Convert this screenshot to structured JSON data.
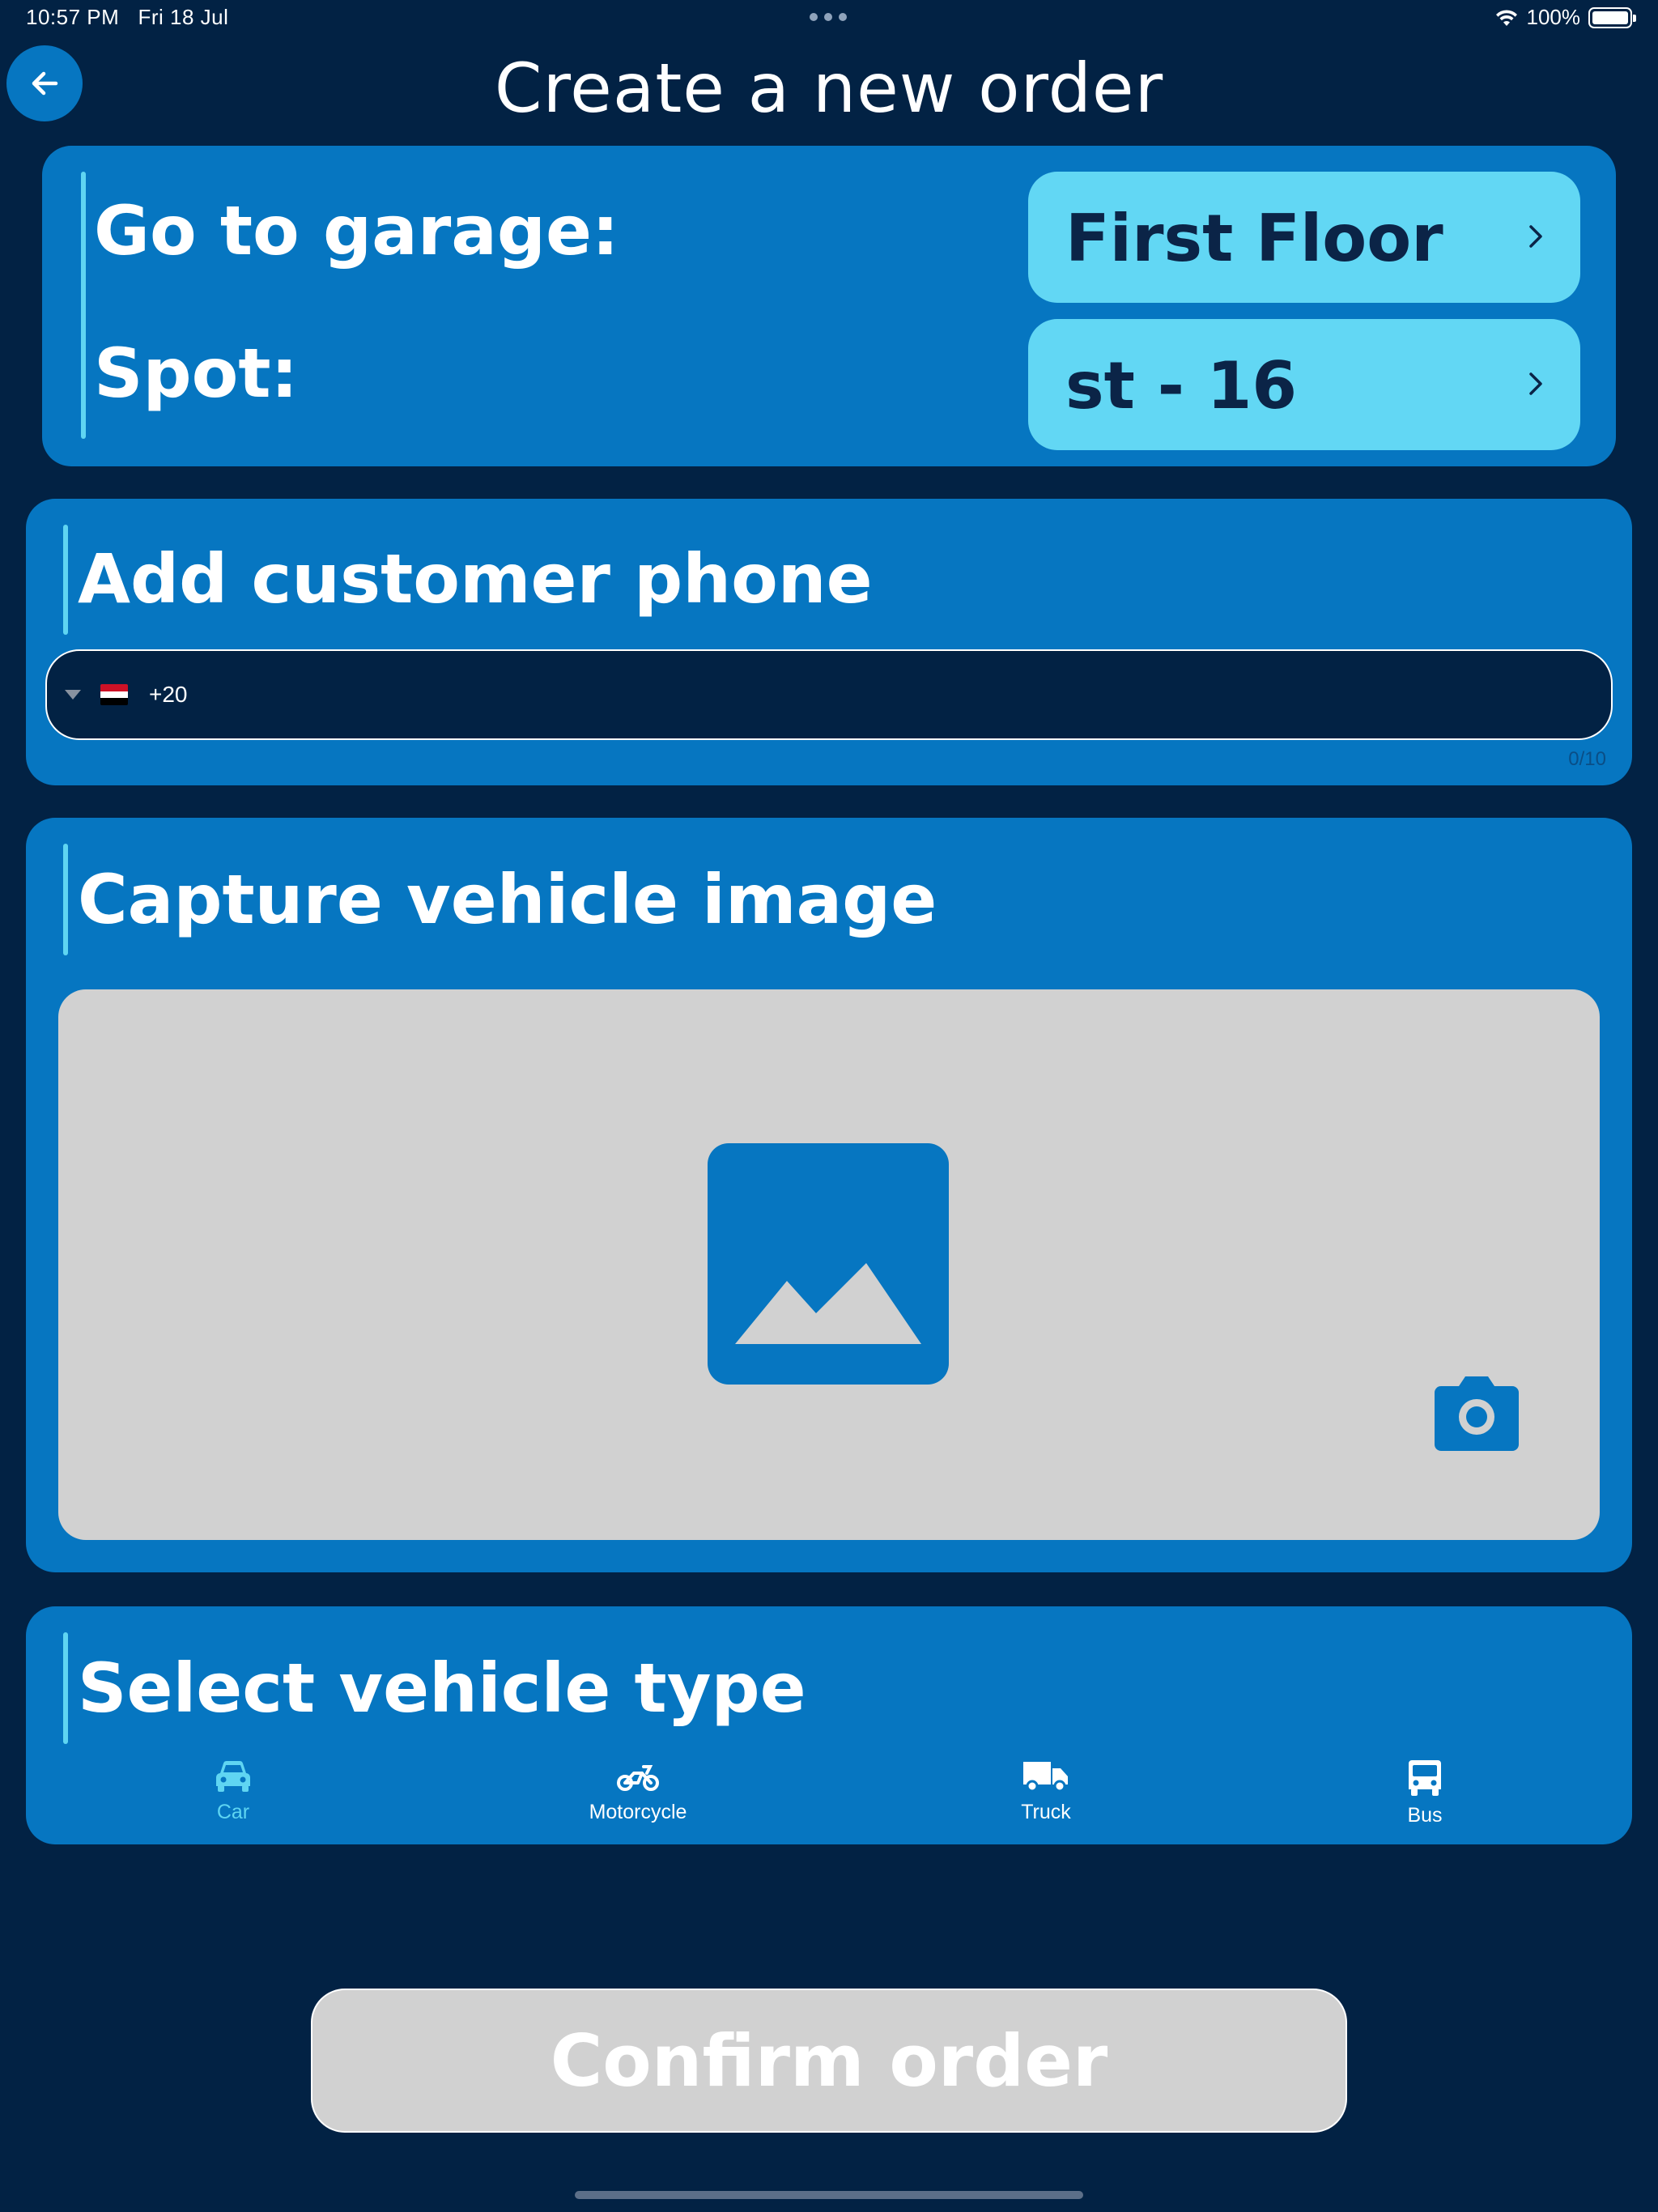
{
  "status_bar": {
    "time": "10:57 PM",
    "date": "Fri 18 Jul",
    "battery": "100%"
  },
  "header": {
    "title": "Create a new order",
    "back_icon": "arrow-left-icon"
  },
  "garage_card": {
    "garage_label": "Go to garage:",
    "spot_label": "Spot:",
    "garage_value": "First Floor",
    "spot_value": "st - 16"
  },
  "phone_card": {
    "heading": "Add customer phone",
    "country_flag": "egypt-flag-icon",
    "dial_code": "+20",
    "value": "",
    "counter": "0/10"
  },
  "image_card": {
    "heading": "Capture vehicle image",
    "placeholder_icon": "image-placeholder-icon",
    "camera_icon": "camera-icon"
  },
  "vehicle_card": {
    "heading": "Select vehicle type",
    "options": [
      {
        "label": "Car",
        "icon": "car-icon",
        "selected": true
      },
      {
        "label": "Motorcycle",
        "icon": "motorcycle-icon",
        "selected": false
      },
      {
        "label": "Truck",
        "icon": "truck-icon",
        "selected": false
      },
      {
        "label": "Bus",
        "icon": "bus-icon",
        "selected": false
      }
    ]
  },
  "confirm": {
    "label": "Confirm order",
    "enabled": false
  },
  "colors": {
    "background": "#022244",
    "card": "#0676c1",
    "accent": "#5fd5f2",
    "selector": "#62d7f4",
    "disabled": "#d1d1d1",
    "selected_vehicle": "#5fd5f2"
  }
}
